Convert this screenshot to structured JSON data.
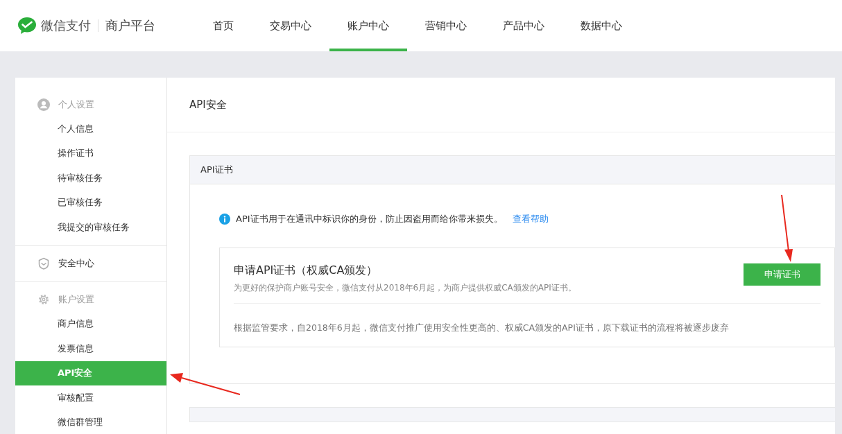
{
  "header": {
    "brand": "微信支付",
    "platform": "商户平台",
    "tabs": [
      {
        "label": "首页",
        "selected": false
      },
      {
        "label": "交易中心",
        "selected": false
      },
      {
        "label": "账户中心",
        "selected": true
      },
      {
        "label": "营销中心",
        "selected": false
      },
      {
        "label": "产品中心",
        "selected": false
      },
      {
        "label": "数据中心",
        "selected": false
      }
    ]
  },
  "sidebar": {
    "groups": [
      {
        "label": "个人设置",
        "kind": "heading",
        "items": [
          {
            "label": "个人信息",
            "selected": false
          },
          {
            "label": "操作证书",
            "selected": false
          },
          {
            "label": "待审核任务",
            "selected": false
          },
          {
            "label": "已审核任务",
            "selected": false
          },
          {
            "label": "我提交的审核任务",
            "selected": false
          }
        ]
      },
      {
        "label": "安全中心",
        "kind": "link"
      },
      {
        "label": "账户设置",
        "kind": "heading",
        "items": [
          {
            "label": "商户信息",
            "selected": false
          },
          {
            "label": "发票信息",
            "selected": false
          },
          {
            "label": "API安全",
            "selected": true
          },
          {
            "label": "审核配置",
            "selected": false
          },
          {
            "label": "微信群管理",
            "selected": false
          }
        ]
      }
    ]
  },
  "main": {
    "title": "API安全",
    "card": {
      "title": "API证书",
      "notice": "API证书用于在通讯中标识你的身份，防止因盗用而给你带来损失。",
      "help_link": "查看帮助",
      "apply": {
        "title": "申请API证书（权威CA颁发）",
        "description": "为更好的保护商户账号安全，微信支付从2018年6月起，为商户提供权威CA颁发的API证书。",
        "button": "申请证书",
        "note": "根据监管要求，自2018年6月起，微信支付推广使用安全性更高的、权威CA颁发的API证书，原下载证书的流程将被逐步废弃"
      }
    }
  }
}
